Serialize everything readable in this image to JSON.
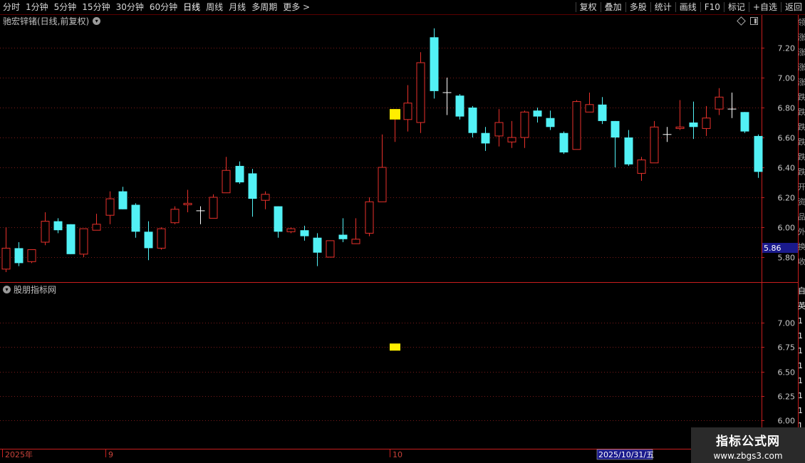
{
  "toolbar": {
    "periods": [
      "分时",
      "1分钟",
      "5分钟",
      "15分钟",
      "30分钟",
      "60分钟",
      "日线",
      "周线",
      "月线",
      "多周期",
      "更多"
    ],
    "more_icon": "chevron-right-icon",
    "active_period": "日线",
    "right_buttons": [
      "复权",
      "叠加",
      "多股",
      "统计",
      "画线",
      "F10",
      "标记",
      "+自选",
      "返回"
    ]
  },
  "main_chart": {
    "title": "驰宏锌锗(日线,前复权)",
    "price_tag": "5.86",
    "y_ticks": [
      "7.20",
      "7.00",
      "6.80",
      "6.60",
      "6.40",
      "6.20",
      "6.00",
      "5.80"
    ]
  },
  "sub_chart": {
    "title": "股朋指标网",
    "y_ticks": [
      "7.00",
      "6.75",
      "6.50",
      "6.25",
      "6.00"
    ]
  },
  "x_axis": {
    "labels": [
      "2025年",
      "9",
      "10"
    ],
    "cursor_date": "2025/10/31/五"
  },
  "right_panel": {
    "chars_top": [
      "领",
      "涨",
      "涨",
      "涨",
      "涨",
      "跌",
      "跌",
      "跌",
      "跌",
      "跌",
      "跌",
      "开",
      "资",
      "品",
      "外",
      "换",
      "收"
    ],
    "chars_bottom": [
      "自",
      "英",
      "1",
      "1",
      "1",
      "1",
      "1",
      "1",
      "1",
      "1",
      "1"
    ]
  },
  "colors": {
    "up": "#e8312b",
    "down": "#52f1f5",
    "highlight": "#ffee00",
    "grid": "#7a1a1a",
    "tag_bg": "#1a1a8c"
  },
  "watermark": {
    "line1": "指标公式网",
    "line2": "www.zbgs3.com"
  },
  "chart_data": {
    "type": "candlestick",
    "title": "驰宏锌锗(日线,前复权)",
    "ylim": [
      5.7,
      7.35
    ],
    "candles": [
      [
        5.72,
        5.86,
        5.7,
        6.0,
        "up"
      ],
      [
        5.86,
        5.76,
        5.74,
        5.9,
        "down"
      ],
      [
        5.77,
        5.85,
        5.76,
        5.85,
        "up"
      ],
      [
        5.9,
        6.04,
        5.88,
        6.1,
        "up"
      ],
      [
        6.04,
        5.98,
        5.96,
        6.06,
        "down"
      ],
      [
        6.02,
        5.82,
        5.82,
        6.02,
        "down"
      ],
      [
        5.82,
        5.99,
        5.8,
        5.99,
        "up"
      ],
      [
        5.98,
        6.02,
        5.98,
        6.09,
        "up"
      ],
      [
        6.08,
        6.19,
        6.02,
        6.24,
        "up"
      ],
      [
        6.24,
        6.12,
        6.12,
        6.27,
        "down"
      ],
      [
        6.15,
        5.97,
        5.93,
        6.16,
        "down"
      ],
      [
        5.97,
        5.86,
        5.78,
        6.04,
        "down"
      ],
      [
        5.86,
        5.99,
        5.85,
        6.0,
        "up"
      ],
      [
        6.03,
        6.12,
        6.02,
        6.14,
        "up"
      ],
      [
        6.15,
        6.16,
        6.1,
        6.25,
        "up"
      ],
      [
        6.11,
        6.1,
        6.02,
        6.14,
        "cross"
      ],
      [
        6.06,
        6.2,
        6.06,
        6.22,
        "up"
      ],
      [
        6.23,
        6.38,
        6.23,
        6.47,
        "up"
      ],
      [
        6.41,
        6.3,
        6.29,
        6.44,
        "down"
      ],
      [
        6.36,
        6.19,
        6.07,
        6.39,
        "down"
      ],
      [
        6.18,
        6.22,
        6.12,
        6.24,
        "up"
      ],
      [
        6.14,
        5.97,
        5.93,
        6.14,
        "down"
      ],
      [
        5.97,
        5.99,
        5.96,
        6.0,
        "up"
      ],
      [
        5.98,
        5.94,
        5.91,
        6.01,
        "down"
      ],
      [
        5.93,
        5.83,
        5.74,
        5.96,
        "down"
      ],
      [
        5.8,
        5.91,
        5.8,
        5.91,
        "up"
      ],
      [
        5.95,
        5.92,
        5.9,
        6.06,
        "down"
      ],
      [
        5.89,
        5.92,
        5.89,
        6.06,
        "up"
      ],
      [
        5.96,
        6.17,
        5.94,
        6.2,
        "up"
      ],
      [
        6.17,
        6.4,
        6.17,
        6.62,
        "up"
      ],
      [
        6.72,
        6.79,
        6.57,
        6.79,
        "highlight"
      ],
      [
        6.72,
        6.83,
        6.64,
        6.95,
        "up"
      ],
      [
        6.7,
        7.1,
        6.63,
        7.17,
        "up"
      ],
      [
        7.27,
        6.91,
        6.86,
        7.33,
        "down"
      ],
      [
        6.9,
        6.9,
        6.75,
        7.0,
        "cross"
      ],
      [
        6.88,
        6.74,
        6.72,
        6.89,
        "down"
      ],
      [
        6.8,
        6.63,
        6.6,
        6.81,
        "down"
      ],
      [
        6.63,
        6.56,
        6.51,
        6.67,
        "down"
      ],
      [
        6.61,
        6.7,
        6.54,
        6.79,
        "up"
      ],
      [
        6.57,
        6.6,
        6.53,
        6.71,
        "up"
      ],
      [
        6.6,
        6.77,
        6.53,
        6.78,
        "up"
      ],
      [
        6.78,
        6.74,
        6.7,
        6.8,
        "down"
      ],
      [
        6.73,
        6.67,
        6.65,
        6.78,
        "down"
      ],
      [
        6.63,
        6.5,
        6.49,
        6.64,
        "down"
      ],
      [
        6.52,
        6.84,
        6.52,
        6.85,
        "up"
      ],
      [
        6.77,
        6.82,
        6.77,
        6.9,
        "up"
      ],
      [
        6.82,
        6.71,
        6.69,
        6.87,
        "down"
      ],
      [
        6.71,
        6.6,
        6.4,
        6.71,
        "down"
      ],
      [
        6.6,
        6.42,
        6.41,
        6.65,
        "down"
      ],
      [
        6.36,
        6.45,
        6.31,
        6.47,
        "up"
      ],
      [
        6.43,
        6.67,
        6.43,
        6.71,
        "up"
      ],
      [
        6.62,
        6.62,
        6.57,
        6.67,
        "cross"
      ],
      [
        6.66,
        6.67,
        6.65,
        6.85,
        "up"
      ],
      [
        6.7,
        6.67,
        6.59,
        6.84,
        "down"
      ],
      [
        6.66,
        6.73,
        6.61,
        6.81,
        "up"
      ],
      [
        6.79,
        6.87,
        6.75,
        6.93,
        "up"
      ],
      [
        6.79,
        6.79,
        6.73,
        6.9,
        "cross"
      ],
      [
        6.77,
        6.64,
        6.63,
        6.77,
        "down"
      ],
      [
        6.61,
        6.37,
        6.33,
        6.62,
        "down"
      ]
    ],
    "sub_marker": {
      "index": 30,
      "value": 6.75
    },
    "sub_ylim": [
      5.97,
      7.17
    ]
  }
}
